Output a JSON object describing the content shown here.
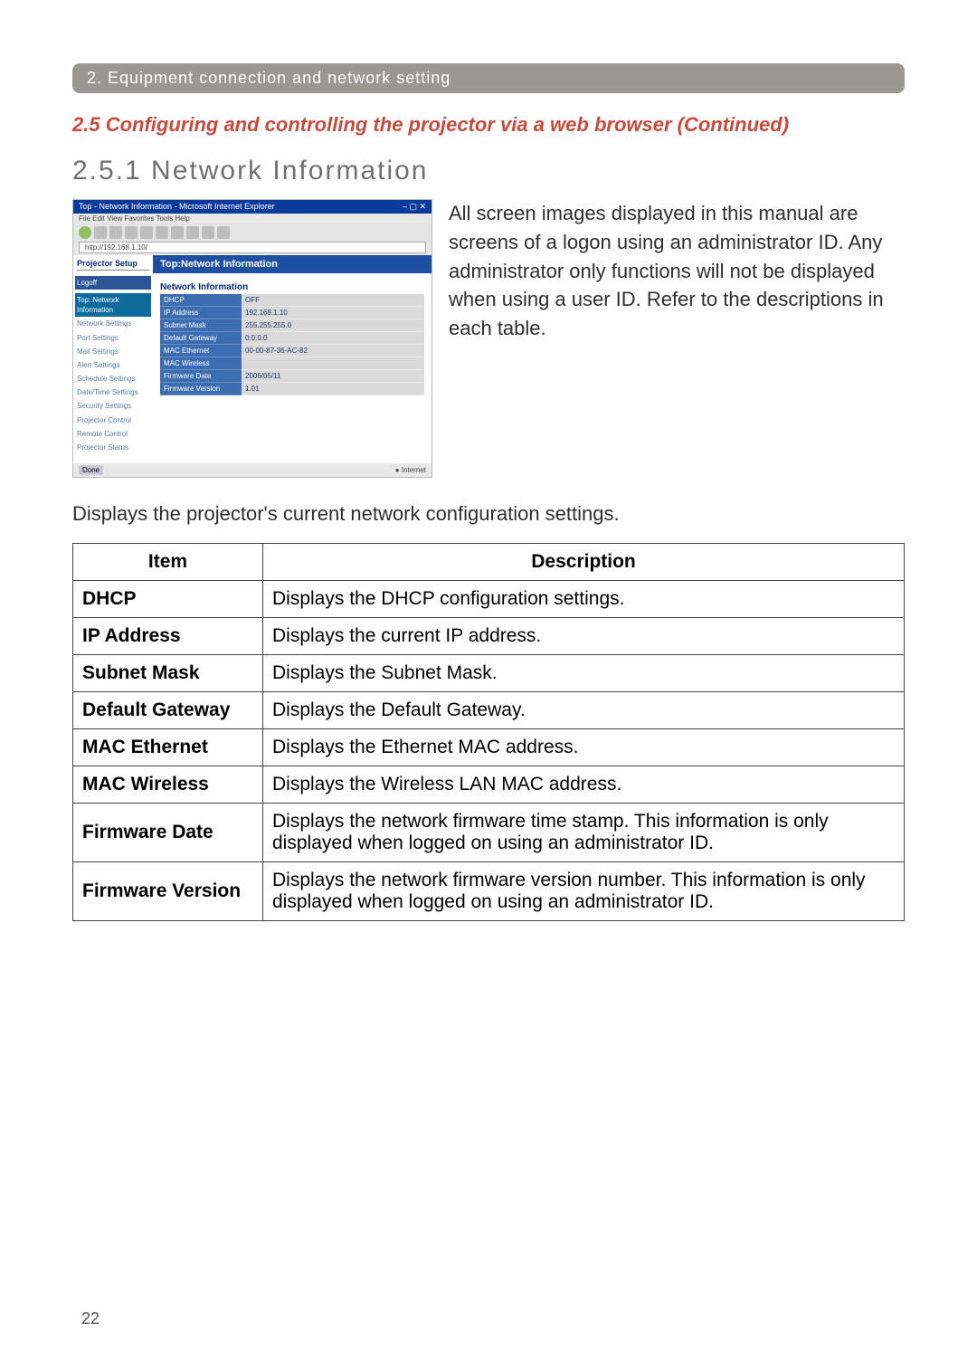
{
  "chapter_bar": "2. Equipment connection and network setting",
  "section_title": "2.5 Configuring and controlling the projector via a web browser (Continued)",
  "subsection_title": "2.5.1 Network Information",
  "browser": {
    "window_title": "Top - Network Information - Microsoft Internet Explorer",
    "menu": "File  Edit  View  Favorites  Tools  Help",
    "address": "http://192.168.1.10/",
    "logo": "Projector Setup",
    "nav_items": [
      "Logoff",
      "Top: Network Information",
      "Network Settings",
      "Port Settings",
      "Mail Settings",
      "Alert Settings",
      "Schedule Settings",
      "Date/Time Settings",
      "Security Settings",
      "Projector Control",
      "Remote Control",
      "Projector Status"
    ],
    "main_title": "Top:Network Information",
    "card_title": "Network Information",
    "rows": [
      {
        "k": "DHCP",
        "v": "OFF"
      },
      {
        "k": "IP Address",
        "v": "192.168.1.10"
      },
      {
        "k": "Subnet Mask",
        "v": "255.255.255.0"
      },
      {
        "k": "Default Gateway",
        "v": "0.0.0.0"
      },
      {
        "k": "MAC Ethernet",
        "v": "00-00-87-36-AC-82"
      },
      {
        "k": "MAC Wireless",
        "v": ""
      },
      {
        "k": "Firmware Date",
        "v": "2006/05/11"
      },
      {
        "k": "Firmware Version",
        "v": "1.01"
      }
    ],
    "status_done": "Done",
    "status_inet": "Internet"
  },
  "paragraph": "All screen images displayed in this manual are screens of a logon using an administrator ID. Any administrator only functions will not be displayed when using a user ID. Refer to the descriptions in each table.",
  "lead": "Displays the projector's current network configuration settings.",
  "table_headers": {
    "item": "Item",
    "desc": "Description"
  },
  "table": [
    {
      "item": "DHCP",
      "desc": "Displays the DHCP configuration settings."
    },
    {
      "item": "IP Address",
      "desc": "Displays the current IP address."
    },
    {
      "item": "Subnet Mask",
      "desc": "Displays the Subnet Mask."
    },
    {
      "item": "Default Gateway",
      "desc": "Displays the Default Gateway."
    },
    {
      "item": "MAC Ethernet",
      "desc": "Displays the Ethernet MAC address."
    },
    {
      "item": "MAC Wireless",
      "desc": "Displays the Wireless LAN MAC address."
    },
    {
      "item": "Firmware Date",
      "desc": "Displays the network firmware time stamp. This information is only displayed when logged on using an administrator ID."
    },
    {
      "item": "Firmware Version",
      "desc": "Displays the network firmware version number. This information is only displayed when logged on using an administrator ID."
    }
  ],
  "page_number": "22"
}
